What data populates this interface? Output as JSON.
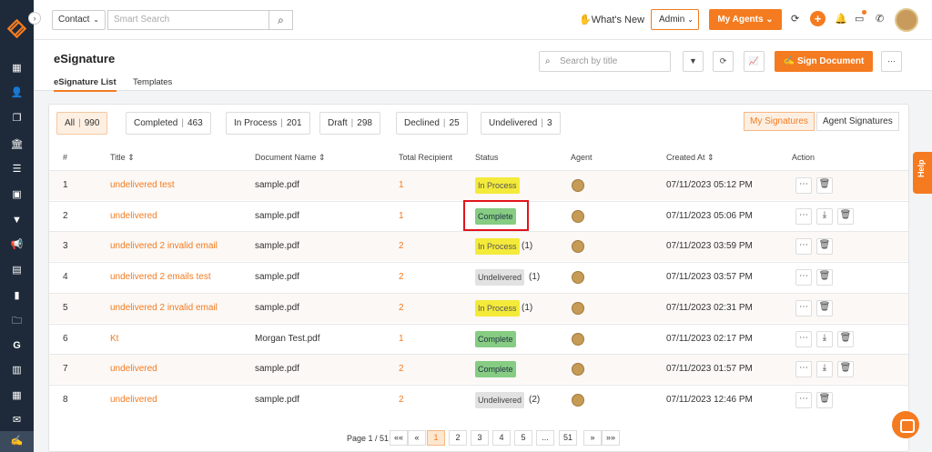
{
  "topbar": {
    "contact_select": "Contact",
    "search_placeholder": "Smart Search",
    "whats_new": "What's New",
    "admin_select": "Admin",
    "my_agents": "My Agents"
  },
  "page": {
    "title": "eSignature",
    "tabs": [
      "eSignature List",
      "Templates"
    ],
    "search_placeholder": "Search by title",
    "sign_button": "Sign Document"
  },
  "filters": [
    {
      "label": "All",
      "count": "990"
    },
    {
      "label": "Completed",
      "count": "463"
    },
    {
      "label": "In Process",
      "count": "201"
    },
    {
      "label": "Draft",
      "count": "298"
    },
    {
      "label": "Declined",
      "count": "25"
    },
    {
      "label": "Undelivered",
      "count": "3"
    }
  ],
  "view_toggle": [
    "My Signatures",
    "Agent Signatures"
  ],
  "table": {
    "headers": [
      "#",
      "Title",
      "Document Name",
      "Total Recipient",
      "Status",
      "Agent",
      "Created At",
      "Action"
    ],
    "rows": [
      {
        "num": "1",
        "title": "undelivered test",
        "doc": "sample.pdf",
        "recipients": "1",
        "status": "In Process",
        "count": "",
        "created": "07/11/2023 05:12 PM"
      },
      {
        "num": "2",
        "title": "undelivered",
        "doc": "sample.pdf",
        "recipients": "1",
        "status": "Complete",
        "count": "",
        "created": "07/11/2023 05:06 PM"
      },
      {
        "num": "3",
        "title": "undelivered 2 invalid email",
        "doc": "sample.pdf",
        "recipients": "2",
        "status": "In Process",
        "count": "(1)",
        "created": "07/11/2023 03:59 PM"
      },
      {
        "num": "4",
        "title": "undelivered 2 emails test",
        "doc": "sample.pdf",
        "recipients": "2",
        "status": "Undelivered",
        "count": "(1)",
        "created": "07/11/2023 03:57 PM"
      },
      {
        "num": "5",
        "title": "undelivered 2 invalid email",
        "doc": "sample.pdf",
        "recipients": "2",
        "status": "In Process",
        "count": "(1)",
        "created": "07/11/2023 02:31 PM"
      },
      {
        "num": "6",
        "title": "Kt",
        "doc": "Morgan Test.pdf",
        "recipients": "1",
        "status": "Complete",
        "count": "",
        "created": "07/11/2023 02:17 PM"
      },
      {
        "num": "7",
        "title": "undelivered",
        "doc": "sample.pdf",
        "recipients": "2",
        "status": "Complete",
        "count": "",
        "created": "07/11/2023 01:57 PM"
      },
      {
        "num": "8",
        "title": "undelivered",
        "doc": "sample.pdf",
        "recipients": "2",
        "status": "Undelivered",
        "count": "(2)",
        "created": "07/11/2023 12:46 PM"
      }
    ]
  },
  "pagination": {
    "label": "Page 1 / 51",
    "pages": [
      "1",
      "2",
      "3",
      "4",
      "5",
      "...",
      "51"
    ]
  },
  "help_label": "Help",
  "colors": {
    "accent": "#f47b20",
    "sidebar": "#1e2a3a"
  }
}
